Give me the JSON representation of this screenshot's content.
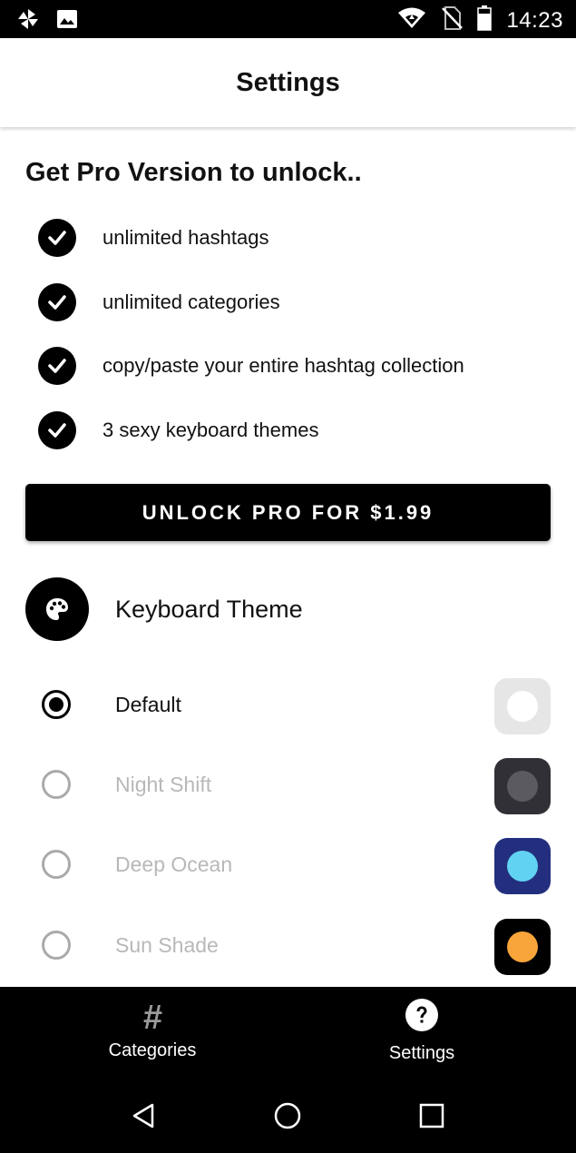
{
  "status_bar": {
    "time": "14:23",
    "left_icons": [
      "pinwheel-icon",
      "image-icon"
    ],
    "right_icons": [
      "wifi-icon",
      "no-sim-icon",
      "battery-icon"
    ]
  },
  "app_bar": {
    "title": "Settings"
  },
  "promo": {
    "heading": "Get Pro Version to unlock..",
    "features": [
      "unlimited hashtags",
      "unlimited categories",
      "copy/paste your entire hashtag collection",
      "3 sexy keyboard themes"
    ],
    "unlock_button_label": "UNLOCK PRO FOR $1.99"
  },
  "keyboard_theme": {
    "header": "Keyboard Theme",
    "themes": [
      {
        "label": "Default",
        "selected": true,
        "enabled": true,
        "swatch_bg": "#e6e6e6",
        "swatch_dot": "#ffffff"
      },
      {
        "label": "Night Shift",
        "selected": false,
        "enabled": false,
        "swatch_bg": "#303036",
        "swatch_dot": "#5a5a60"
      },
      {
        "label": "Deep Ocean",
        "selected": false,
        "enabled": false,
        "swatch_bg": "#232f7e",
        "swatch_dot": "#62d2f2"
      },
      {
        "label": "Sun Shade",
        "selected": false,
        "enabled": false,
        "swatch_bg": "#000000",
        "swatch_dot": "#f7a43b"
      }
    ]
  },
  "bottom_nav": {
    "items": [
      {
        "label": "Categories",
        "icon": "hashtag-icon",
        "active": false
      },
      {
        "label": "Settings",
        "icon": "help-icon",
        "active": true
      }
    ]
  },
  "colors": {
    "accent": "#000000",
    "disabled_text": "#b8b8b8"
  }
}
